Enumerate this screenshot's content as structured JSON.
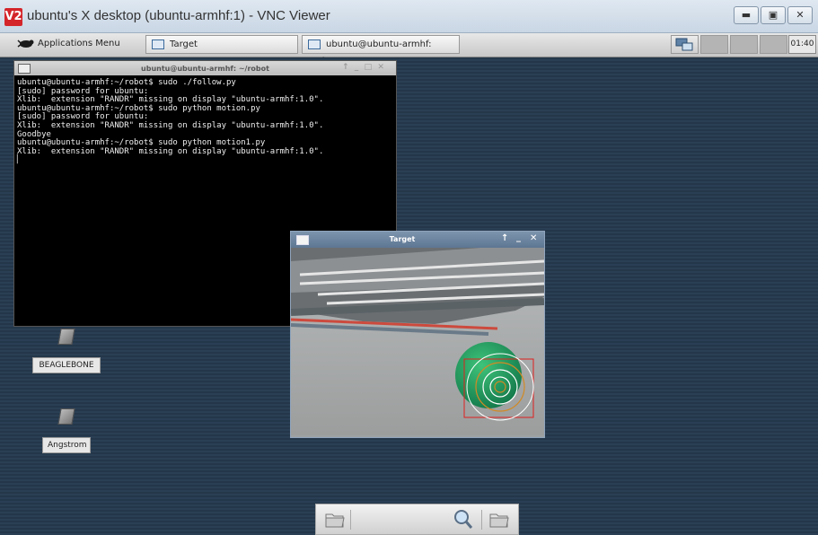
{
  "window": {
    "title": "ubuntu's X desktop (ubuntu-armhf:1) - VNC Viewer",
    "logo": "V2",
    "minimize_icon": "minimize-icon",
    "restore_icon": "restore-icon",
    "close_icon": "close-icon"
  },
  "panel": {
    "apps_menu_label": "Applications Menu",
    "tasks": [
      {
        "label": "Target"
      },
      {
        "label": "ubuntu@ubuntu-armhf: ~/robot"
      }
    ],
    "clock": "01:40"
  },
  "terminal": {
    "title": "ubuntu@ubuntu-armhf: ~/robot",
    "lines": [
      "ubuntu@ubuntu-armhf:~/robot$ sudo ./follow.py",
      "[sudo] password for ubuntu:",
      "Xlib:  extension \"RANDR\" missing on display \"ubuntu-armhf:1.0\".",
      "ubuntu@ubuntu-armhf:~/robot$ sudo python motion.py",
      "[sudo] password for ubuntu:",
      "Xlib:  extension \"RANDR\" missing on display \"ubuntu-armhf:1.0\".",
      "Goodbye",
      "ubuntu@ubuntu-armhf:~/robot$ sudo python motion1.py",
      "Xlib:  extension \"RANDR\" missing on display \"ubuntu-armhf:1.0\".",
      "▏"
    ]
  },
  "target_window": {
    "title": "Target"
  },
  "desktop_icons": [
    {
      "label": "BEAGLEBONE"
    },
    {
      "label": "Angstrom"
    }
  ],
  "colors": {
    "vnc_logo": "#d4252a",
    "desktop": "#24374a",
    "ball": "#1fa35a",
    "tracking_box": "#e0201f"
  }
}
